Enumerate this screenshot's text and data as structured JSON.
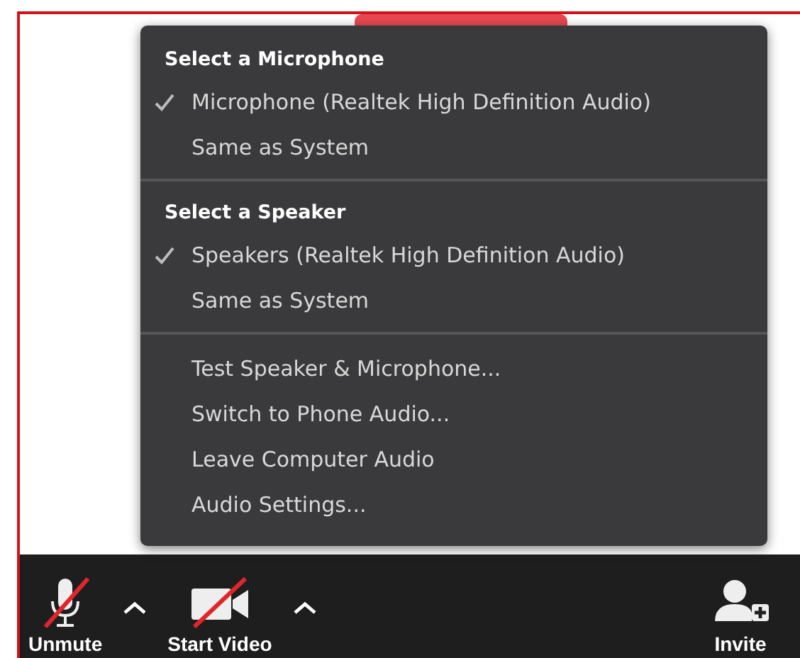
{
  "menu": {
    "sections": [
      {
        "heading": "Select a Microphone",
        "items": [
          {
            "label": "Microphone (Realtek High Definition Audio)",
            "checked": true
          },
          {
            "label": "Same as System",
            "checked": false
          }
        ]
      },
      {
        "heading": "Select a Speaker",
        "items": [
          {
            "label": "Speakers (Realtek High Definition Audio)",
            "checked": true
          },
          {
            "label": "Same as System",
            "checked": false
          }
        ]
      },
      {
        "items": [
          {
            "label": "Test Speaker & Microphone...",
            "checked": false
          },
          {
            "label": "Switch to Phone Audio...",
            "checked": false
          },
          {
            "label": "Leave Computer Audio",
            "checked": false
          },
          {
            "label": "Audio Settings...",
            "checked": false
          }
        ]
      }
    ]
  },
  "toolbar": {
    "items": [
      {
        "kind": "mic",
        "label": "Unmute",
        "off": true
      },
      {
        "kind": "caret"
      },
      {
        "kind": "video",
        "label": "Start Video",
        "off": true
      },
      {
        "kind": "caret"
      },
      {
        "kind": "invite",
        "label": "Invite"
      }
    ]
  }
}
